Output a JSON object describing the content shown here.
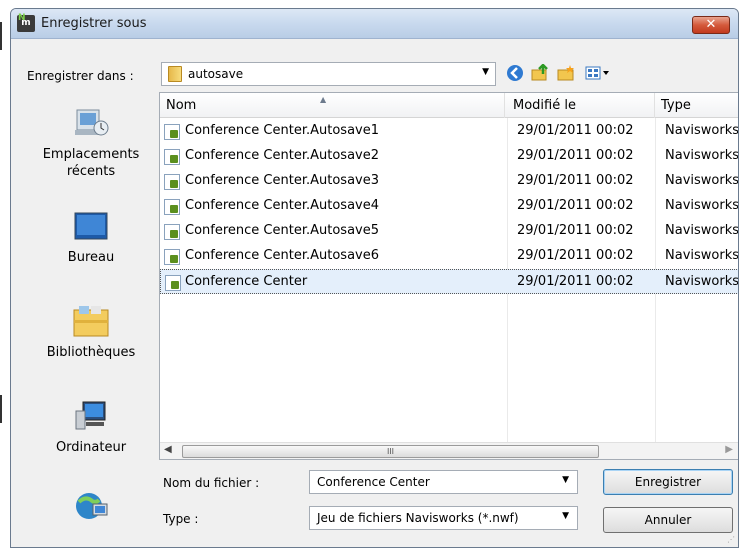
{
  "window": {
    "title": "Enregistrer sous",
    "close_label": "✕"
  },
  "save_in": {
    "label": "Enregistrer dans :",
    "value": "autosave"
  },
  "toolbar": {
    "icons": [
      "back-icon",
      "up-folder-icon",
      "new-folder-icon",
      "view-menu-icon"
    ]
  },
  "places": [
    {
      "label_line1": "Emplacements",
      "label_line2": "récents",
      "icon": "recent-places-icon"
    },
    {
      "label_line1": "Bureau",
      "label_line2": "",
      "icon": "desktop-icon"
    },
    {
      "label_line1": "Bibliothèques",
      "label_line2": "",
      "icon": "libraries-icon"
    },
    {
      "label_line1": "Ordinateur",
      "label_line2": "",
      "icon": "computer-icon"
    },
    {
      "label_line1": "",
      "label_line2": "",
      "icon": "network-icon"
    }
  ],
  "list": {
    "columns": [
      "Nom",
      "Modifié le",
      "Type"
    ],
    "rows": [
      {
        "name": "Conference Center.Autosave1",
        "modified": "29/01/2011 00:02",
        "type": "Navisworks"
      },
      {
        "name": "Conference Center.Autosave2",
        "modified": "29/01/2011 00:02",
        "type": "Navisworks"
      },
      {
        "name": "Conference Center.Autosave3",
        "modified": "29/01/2011 00:02",
        "type": "Navisworks"
      },
      {
        "name": "Conference Center.Autosave4",
        "modified": "29/01/2011 00:02",
        "type": "Navisworks"
      },
      {
        "name": "Conference Center.Autosave5",
        "modified": "29/01/2011 00:02",
        "type": "Navisworks"
      },
      {
        "name": "Conference Center.Autosave6",
        "modified": "29/01/2011 00:02",
        "type": "Navisworks"
      },
      {
        "name": "Conference Center",
        "modified": "29/01/2011 00:02",
        "type": "Navisworks"
      }
    ],
    "selected_index": 6,
    "scroll_thumb_label": "III"
  },
  "filename": {
    "label": "Nom du fichier :",
    "value": "Conference Center"
  },
  "filetype": {
    "label": "Type :",
    "value": "Jeu de fichiers Navisworks (*.nwf)"
  },
  "buttons": {
    "save": "Enregistrer",
    "cancel": "Annuler"
  },
  "colors": {
    "selection": "#e4effb",
    "close_button": "#c23a1e"
  }
}
